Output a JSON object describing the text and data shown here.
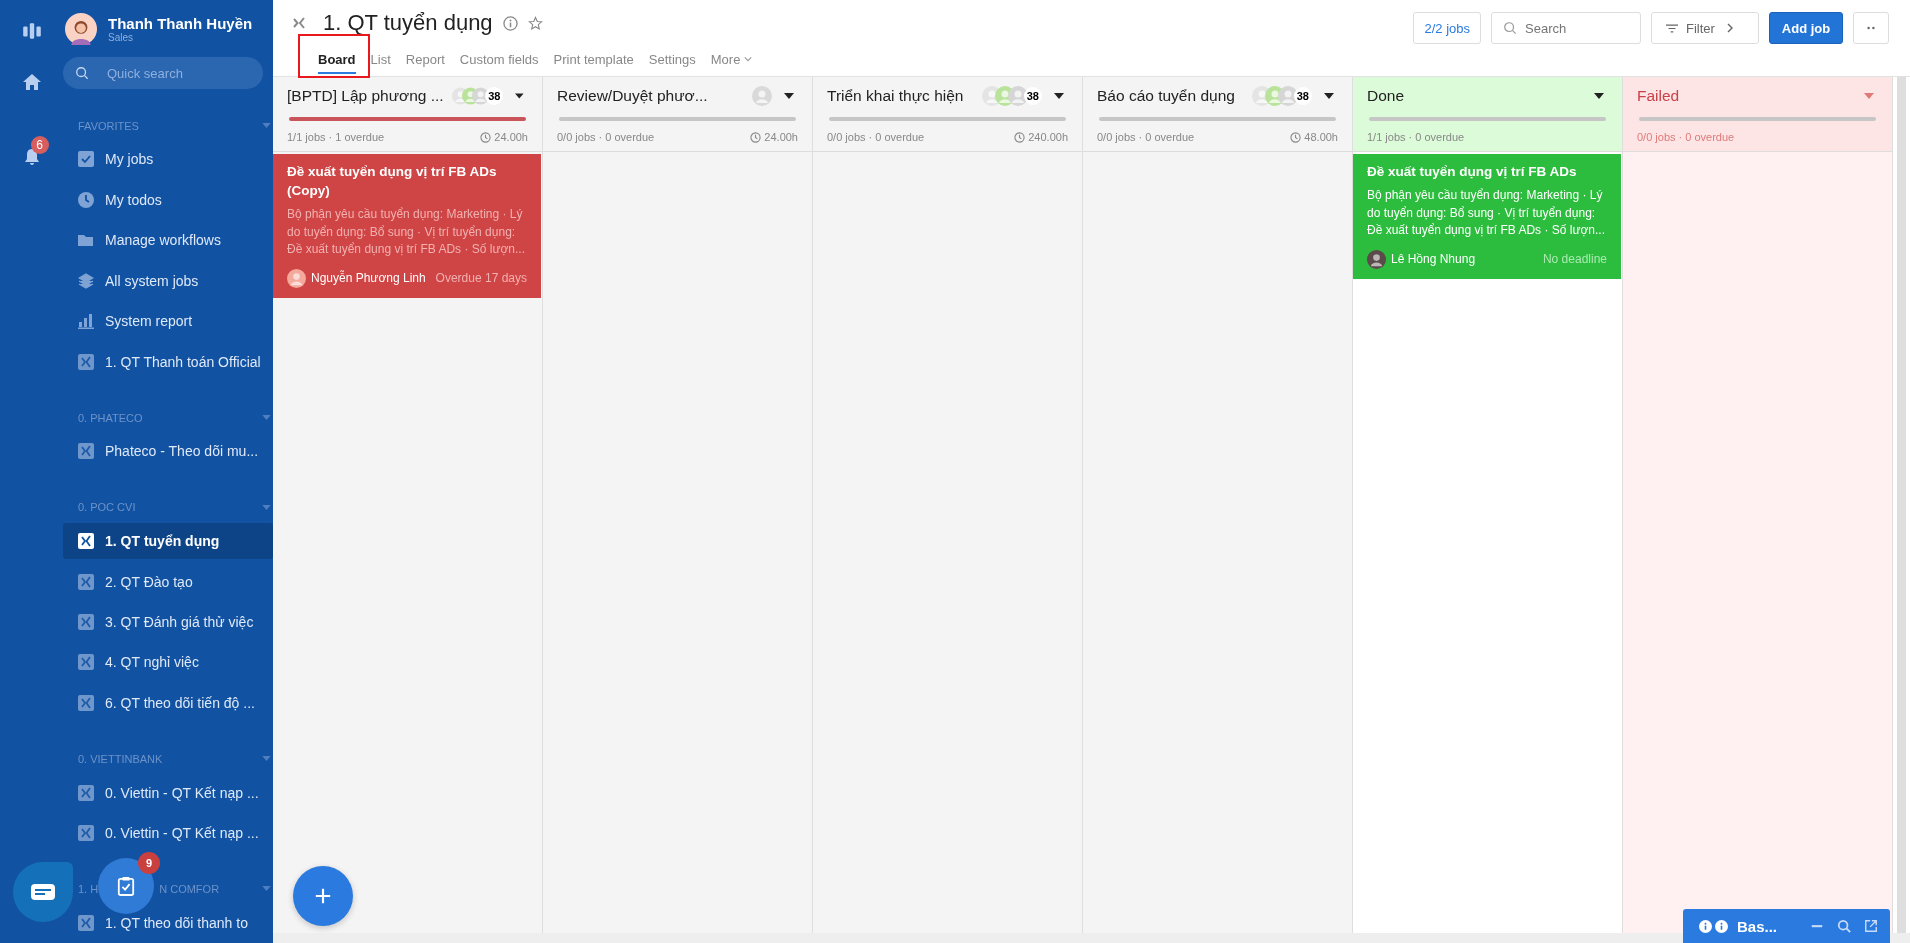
{
  "rail": {
    "notification_badge": "6"
  },
  "user": {
    "name": "Thanh Thanh Huyền",
    "role": "Sales"
  },
  "quick_search": {
    "placeholder": "Quick search"
  },
  "sidebar": {
    "sections": [
      {
        "heading": [
          "FAVORITES"
        ],
        "items": [
          {
            "kind": "shortcut",
            "label": "My jobs",
            "selected": false
          },
          {
            "kind": "shortcut",
            "label": "My todos",
            "selected": false
          },
          {
            "kind": "shortcut",
            "label": "Manage workflows",
            "selected": false
          },
          {
            "kind": "shortcut",
            "label": "All system jobs",
            "selected": false
          },
          {
            "kind": "shortcut",
            "label": "System report",
            "selected": false
          },
          {
            "kind": "workflow",
            "label": "1. QT Thanh toán Official",
            "selected": false
          }
        ]
      },
      {
        "heading": [
          "0. PHATECO"
        ],
        "items": [
          {
            "kind": "workflow",
            "label": "Phateco - Theo dõi mu...",
            "selected": false
          }
        ]
      },
      {
        "heading": [
          "0. POC CVI"
        ],
        "items": [
          {
            "kind": "workflow",
            "label": "1. QT tuyển dụng",
            "selected": true
          },
          {
            "kind": "workflow",
            "label": "2. QT Đào tạo",
            "selected": false
          },
          {
            "kind": "workflow",
            "label": "3. QT Đánh giá thử việc",
            "selected": false
          },
          {
            "kind": "workflow",
            "label": "4. QT nghỉ việc",
            "selected": false
          },
          {
            "kind": "workflow",
            "label": "6. QT theo dõi tiến độ ...",
            "selected": false
          }
        ]
      },
      {
        "heading": [
          "0. VIETTINBANK"
        ],
        "items": [
          {
            "kind": "workflow",
            "label": "0. Viettin - QT Kết nạp ...",
            "selected": false
          },
          {
            "kind": "workflow",
            "label": "0. Viettin - QT Kết nạp ...",
            "selected": false
          }
        ]
      },
      {
        "heading": [
          "1. H",
          "N COMFOR"
        ],
        "items": [
          {
            "kind": "workflow",
            "label": "1. QT theo dõi thanh to",
            "selected": false
          }
        ]
      }
    ]
  },
  "floating": {
    "tasks_badge": "9"
  },
  "page": {
    "title": "1. QT tuyển dụng",
    "tabs": [
      {
        "label": "Board",
        "selected": true,
        "highlighted": true
      },
      {
        "label": "List",
        "selected": false,
        "highlighted": false
      },
      {
        "label": "Report",
        "selected": false,
        "highlighted": false
      },
      {
        "label": "Custom fields",
        "selected": false,
        "highlighted": false
      },
      {
        "label": "Print template",
        "selected": false,
        "highlighted": false
      },
      {
        "label": "Settings",
        "selected": false,
        "highlighted": false
      },
      {
        "label": "More",
        "selected": false,
        "highlighted": false
      }
    ],
    "job_count": "2/2 jobs",
    "search": {
      "placeholder": "Search"
    },
    "filter": "Filter",
    "add_job": "Add job"
  },
  "columns": [
    {
      "kind": "normal",
      "title": "[BPTD] Lập phương ...",
      "avatars": [
        {
          "color": "#e4e4e4"
        },
        {
          "color": "#b9e39a"
        },
        {
          "color": "#d6d6d6"
        }
      ],
      "count": "38",
      "overdue": true,
      "stats": "1/1 jobs · 1 overdue",
      "time": "24.00h",
      "cards": [
        {
          "kind": "overdue",
          "title": "Đề xuất tuyển dụng vị trí FB ADs (Copy)",
          "description": "Bộ phận yêu cầu tuyển dụng: Marketing · Lý do tuyển dụng: Bổ sung · Vị trí tuyển dụng: Đề xuất tuyển dụng vị trí FB ADs · Số lượn...",
          "assignee": "Nguyễn Phương Linh",
          "due": "Overdue 17 days"
        }
      ]
    },
    {
      "kind": "normal",
      "title": "Review/Duyệt phươ...",
      "avatars": [
        {
          "color": "#d9d9d9"
        }
      ],
      "overdue": false,
      "stats": "0/0 jobs · 0 overdue",
      "time": "24.00h"
    },
    {
      "kind": "normal",
      "title": "Triển khai thực hiện",
      "avatars": [
        {
          "color": "#e4e4e4"
        },
        {
          "color": "#b9e39a"
        },
        {
          "color": "#d6d6d6"
        }
      ],
      "count": "38",
      "overdue": false,
      "stats": "0/0 jobs · 0 overdue",
      "time": "240.00h"
    },
    {
      "kind": "normal",
      "title": "Báo cáo tuyển dụng",
      "avatars": [
        {
          "color": "#e4e4e4"
        },
        {
          "color": "#b9e39a"
        },
        {
          "color": "#d6d6d6"
        }
      ],
      "count": "38",
      "overdue": false,
      "stats": "0/0 jobs · 0 overdue",
      "time": "48.00h"
    },
    {
      "kind": "done",
      "title": "Done",
      "overdue": false,
      "stats": "1/1 jobs · 0 overdue",
      "cards": [
        {
          "kind": "done",
          "title": "Đề xuất tuyển dụng vị trí FB ADs",
          "description": "Bộ phận yêu cầu tuyển dụng: Marketing · Lý do tuyển dụng: Bổ sung · Vị trí tuyển dụng: Đề xuất tuyển dụng vị trí FB ADs · Số lượn...",
          "assignee": "Lê Hồng Nhung",
          "due": "No deadline"
        }
      ]
    },
    {
      "kind": "failed",
      "title": "Failed",
      "overdue": false,
      "stats": "0/0 jobs · 0 overdue"
    }
  ],
  "widget": {
    "title": "Bas..."
  }
}
